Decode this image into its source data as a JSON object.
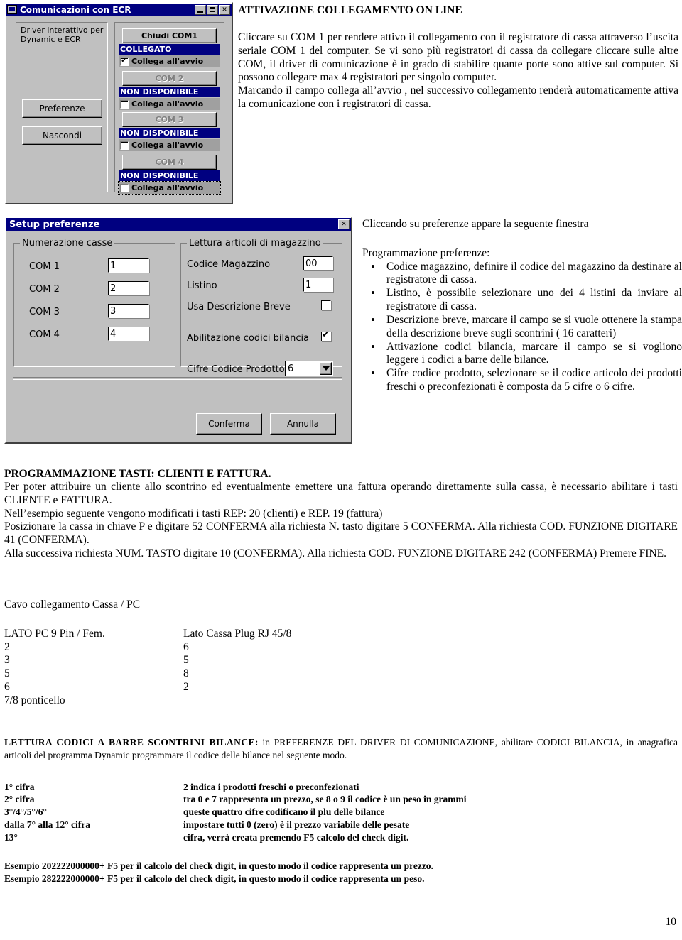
{
  "dialog1": {
    "title": "Comunicazioni con ECR",
    "icon": "computer-icon",
    "minimize_label": "",
    "maximize_label": "",
    "close_label": "✕",
    "description_line1": "Driver interattivo per",
    "description_line2": "Dynamic e ECR",
    "preferenze_button": "Preferenze",
    "nascondi_button": "Nascondi",
    "ports": [
      {
        "button": "Chiudi COM1",
        "status": "COLLEGATO",
        "checkbox_label": "Collega all'avvio",
        "checked": true,
        "enabled": true
      },
      {
        "button": "COM 2",
        "status": "NON DISPONIBILE",
        "checkbox_label": "Collega all'avvio",
        "checked": false,
        "enabled": false
      },
      {
        "button": "COM 3",
        "status": "NON DISPONIBILE",
        "checkbox_label": "Collega all'avvio",
        "checked": false,
        "enabled": false
      },
      {
        "button": "COM 4",
        "status": "NON DISPONIBILE",
        "checkbox_label": "Collega all'avvio",
        "checked": false,
        "enabled": false
      }
    ]
  },
  "dialog2": {
    "title": "Setup preferenze",
    "close_label": "✕",
    "group_left_title": "Numerazione casse",
    "group_right_title": "Lettura articoli di magazzino",
    "com_rows": [
      {
        "label": "COM 1",
        "value": "1"
      },
      {
        "label": "COM 2",
        "value": "2"
      },
      {
        "label": "COM 3",
        "value": "3"
      },
      {
        "label": "COM 4",
        "value": "4"
      }
    ],
    "codice_magazzino_label": "Codice Magazzino",
    "codice_magazzino_value": "00",
    "listino_label": "Listino",
    "listino_value": "1",
    "usa_descrizione_label": "Usa Descrizione Breve",
    "usa_descrizione_checked": false,
    "abilitazione_label": "Abilitazione codici bilancia",
    "abilitazione_checked": true,
    "cifre_label": "Cifre Codice Prodotto",
    "cifre_value": "6",
    "conferma_button": "Conferma",
    "annulla_button": "Annulla"
  },
  "section_online": {
    "heading": "ATTIVAZIONE COLLEGAMENTO ON LINE",
    "paragraph1": "Cliccare su COM 1 per rendere attivo il collegamento con il registratore di cassa attraverso l’uscita seriale COM 1 del computer. Se vi sono più registratori di cassa da collegare cliccare sulle altre COM, il driver di comunicazione è in grado di stabilire quante porte sono attive sul computer. Si possono collegare max 4 registratori per singolo computer.",
    "paragraph2": "Marcando il campo collega all’avvio , nel successivo collegamento renderà automaticamente attiva la comunicazione con i registratori di cassa."
  },
  "section_preferenze": {
    "intro": "Cliccando su preferenze appare la seguente finestra",
    "subtitle": "Programmazione preferenze:",
    "bullets": [
      "Codice magazzino, definire il codice del magazzino da destinare al registratore di cassa.",
      "Listino, è possibile selezionare uno dei 4 listini da inviare al registratore di cassa.",
      "Descrizione breve, marcare il campo se si vuole ottenere la stampa della descrizione breve sugli scontrini ( 16 caratteri)",
      "Attivazione codici bilancia, marcare il campo se si vogliono leggere i codici a barre delle bilance.",
      "Cifre codice prodotto, selezionare se il codice articolo dei prodotti freschi o preconfezionati è composta da 5 cifre o 6 cifre."
    ]
  },
  "section_tasti": {
    "heading": "PROGRAMMAZIONE TASTI: CLIENTI E FATTURA.",
    "paragraph1": "Per poter attribuire un cliente allo scontrino ed eventualmente emettere una fattura operando direttamente sulla cassa, è necessario abilitare i tasti CLIENTE e FATTURA.",
    "paragraph2": "Nell’esempio seguente vengono modificati i tasti REP: 20 (clienti) e REP. 19 (fattura)",
    "paragraph3": "Posizionare  la cassa in chiave P e digitare 52 CONFERMA alla richiesta N. tasto digitare 5 CONFERMA. Alla richiesta COD. FUNZIONE DIGITARE 41 (CONFERMA).",
    "paragraph4": "Alla successiva richiesta NUM. TASTO digitare 10 (CONFERMA). Alla richiesta COD. FUNZIONE DIGITARE 242 (CONFERMA) Premere FINE."
  },
  "section_cavo": {
    "heading": "Cavo collegamento Cassa / PC",
    "col1_header": "LATO PC 9 Pin / Fem.",
    "col2_header": "Lato Cassa Plug RJ 45/8",
    "rows": [
      {
        "pc": "2",
        "cassa": "6"
      },
      {
        "pc": "3",
        "cassa": "5"
      },
      {
        "pc": "5",
        "cassa": "8"
      },
      {
        "pc": "6",
        "cassa": "2"
      },
      {
        "pc": "7/8 ponticello",
        "cassa": ""
      }
    ]
  },
  "section_barre": {
    "heading": "LETTURA CODICI A BARRE SCONTRINI BILANCE:",
    "heading_rest": " in PREFERENZE DEL DRIVER DI COMUNICAZIONE, abilitare CODICI BILANCIA, in anagrafica articoli del programma Dynamic programmare il codice delle bilance nel seguente modo.",
    "table": [
      {
        "cifra": "1° cifra",
        "desc": "2 indica i prodotti freschi o preconfezionati"
      },
      {
        "cifra": "2° cifra",
        "desc": "tra 0 e 7 rappresenta un prezzo, se 8 o 9 il codice è un peso in grammi"
      },
      {
        "cifra": "3°/4°/5°/6°",
        "desc": "queste quattro cifre codificano il plu delle bilance"
      },
      {
        "cifra": "dalla 7° alla 12° cifra",
        "desc": "impostare tutti 0 (zero) è il prezzo variabile delle pesate"
      },
      {
        "cifra": "13°",
        "desc": "cifra, verrà creata premendo F5 calcolo del check digit."
      }
    ],
    "example1": "Esempio 202222000000+ F5 per il calcolo del check digit, in questo modo il codice rappresenta un prezzo.",
    "example2": "Esempio 282222000000+ F5 per il calcolo del check digit, in questo modo il codice rappresenta un peso."
  },
  "footer": {
    "page_number": "10"
  }
}
